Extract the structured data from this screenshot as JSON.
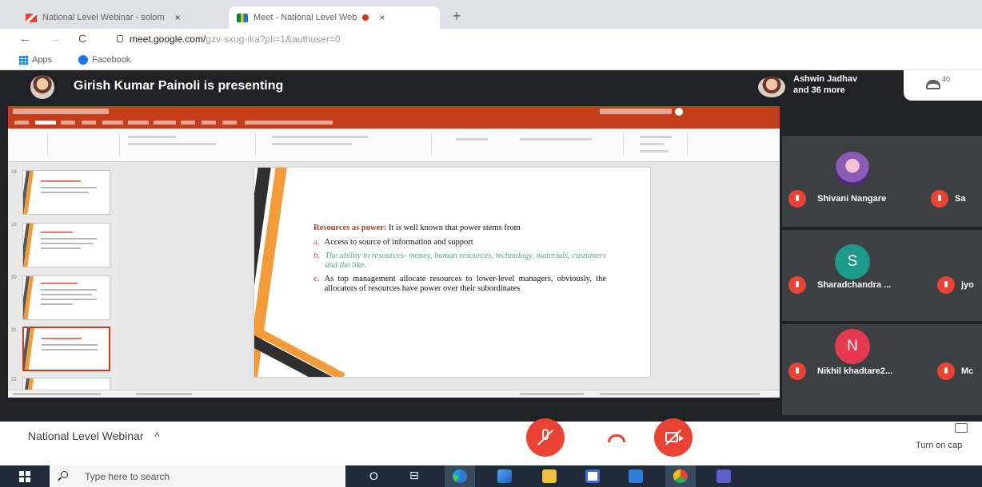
{
  "browser": {
    "tabs": [
      {
        "title": "National Level Webinar - solom",
        "active": false
      },
      {
        "title": "Meet - National Level Web",
        "active": true
      }
    ],
    "url_host": "meet.google.com/",
    "url_rest": "gzv-sxug-ika?pli=1&authuser=0",
    "bookmarks": [
      "Apps",
      "Facebook"
    ],
    "icons": {
      "back": "←",
      "forward": "→",
      "reload": "C",
      "close": "×",
      "new_tab": "+"
    }
  },
  "meet": {
    "presenter_text": "Girish Kumar Painoli is presenting",
    "participants_line1": "Ashwin Jadhav",
    "participants_line2": "and 36 more",
    "people_count": "40",
    "tiles": [
      {
        "name": "Shivani Nangare",
        "side_name": "Sa",
        "avatar": "photo",
        "color": "#6b4c9a"
      },
      {
        "name": "Sharadchandra ...",
        "side_name": "jyo",
        "avatar": "S",
        "color": "#1e9a8a"
      },
      {
        "name": "Nikhil khadtare2...",
        "side_name": "Mc",
        "avatar": "N",
        "color": "#e5394f"
      }
    ]
  },
  "slide": {
    "heading": "Resources as power:",
    "intro": "It is well known that power stems from",
    "points": [
      {
        "marker": "a.",
        "text": "Access to source of information and support",
        "style": "normal"
      },
      {
        "marker": "b.",
        "text": "The ability to resources- money, human resources, technology, materials, customers and the like.",
        "style": "green"
      },
      {
        "marker": "c.",
        "text": "As top management allocate resources to lower-level managers, obviously, the allocators of resources have power over their subordinates",
        "style": "normal"
      }
    ]
  },
  "controls": {
    "meeting_title": "National Level Webinar",
    "expand_icon": "^",
    "captions_label": "Turn on cap"
  },
  "taskbar": {
    "search_placeholder": "Type here to search",
    "cortana": "O",
    "taskview": "⊟"
  },
  "colors": {
    "meet_bg": "#202124",
    "tile_bg": "#3c4043",
    "ppt_accent": "#c43e1c",
    "slide_orange": "#f29b38",
    "mute_red": "#ea4335",
    "taskbar": "#1f2b3a"
  }
}
